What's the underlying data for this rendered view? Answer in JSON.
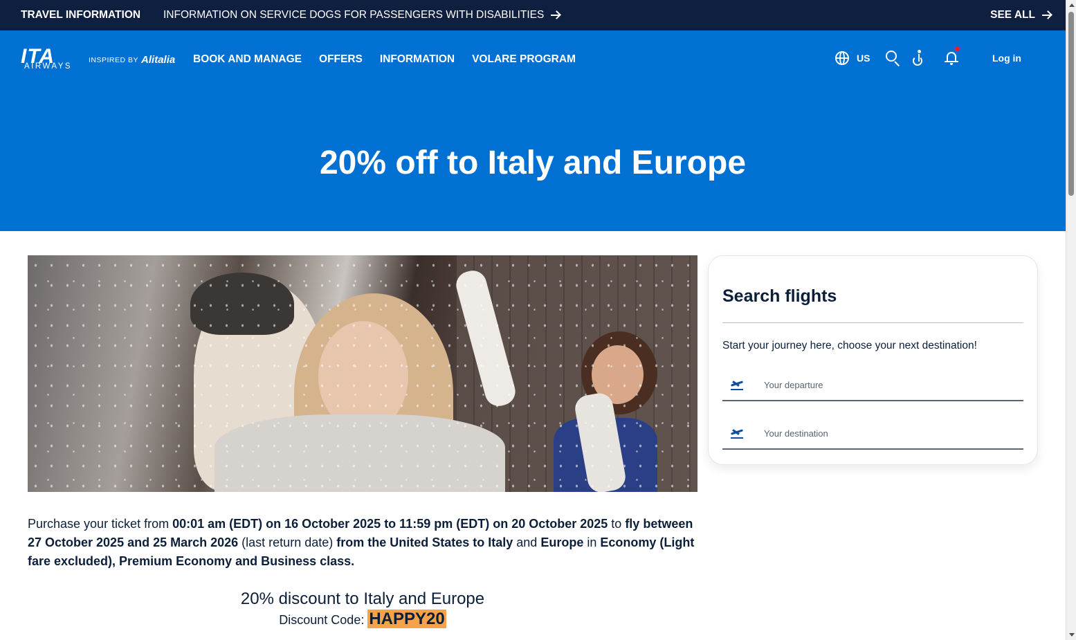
{
  "infobar": {
    "label": "TRAVEL INFORMATION",
    "notice": "INFORMATION ON SERVICE DOGS FOR PASSENGERS WITH DISABILITIES",
    "see_all": "SEE ALL"
  },
  "brand": {
    "logo_text": "ITA",
    "logo_sub": "AIRWAYS",
    "inspired_by": "INSPIRED BY",
    "partner": "Alitalia"
  },
  "nav": {
    "items": [
      {
        "label": "BOOK AND MANAGE"
      },
      {
        "label": "OFFERS"
      },
      {
        "label": "INFORMATION"
      },
      {
        "label": "VOLARE PROGRAM"
      }
    ]
  },
  "tools": {
    "language": "US",
    "icons": [
      "globe-icon",
      "search-icon",
      "accessibility-icon",
      "bell-icon"
    ],
    "login": "Log in"
  },
  "hero": {
    "title": "20% off to Italy and Europe"
  },
  "search_card": {
    "title": "Search flights",
    "intro": "Start your journey here, choose your next destination!",
    "departure_placeholder": "Your departure",
    "destination_placeholder": "Your destination"
  },
  "promo": {
    "t1": "Purchase your ticket from ",
    "b1": "00:01 am (EDT) on 16 October 2025 to 11:59 pm (EDT) on 20 October 2025",
    "t2": " to ",
    "b2": "fly between 27 October 2025 and 25 March 2026",
    "t3": " (last return date) ",
    "b3": "from the United States to Italy",
    "t4": " and ",
    "b4": "Europe",
    "t5": " in ",
    "b5": "Economy (Light fare excluded), Premium Economy and Business class."
  },
  "discount": {
    "title": "20% discount to Italy and Europe",
    "code_label": "Discount Code: ",
    "code": "HAPPY20"
  },
  "colors": {
    "topbar": "#0e1f3f",
    "brand_blue": "#0071d2",
    "text_navy": "#0b1f3a",
    "highlight": "#f5a24b",
    "notification_dot": "#e0203a"
  }
}
